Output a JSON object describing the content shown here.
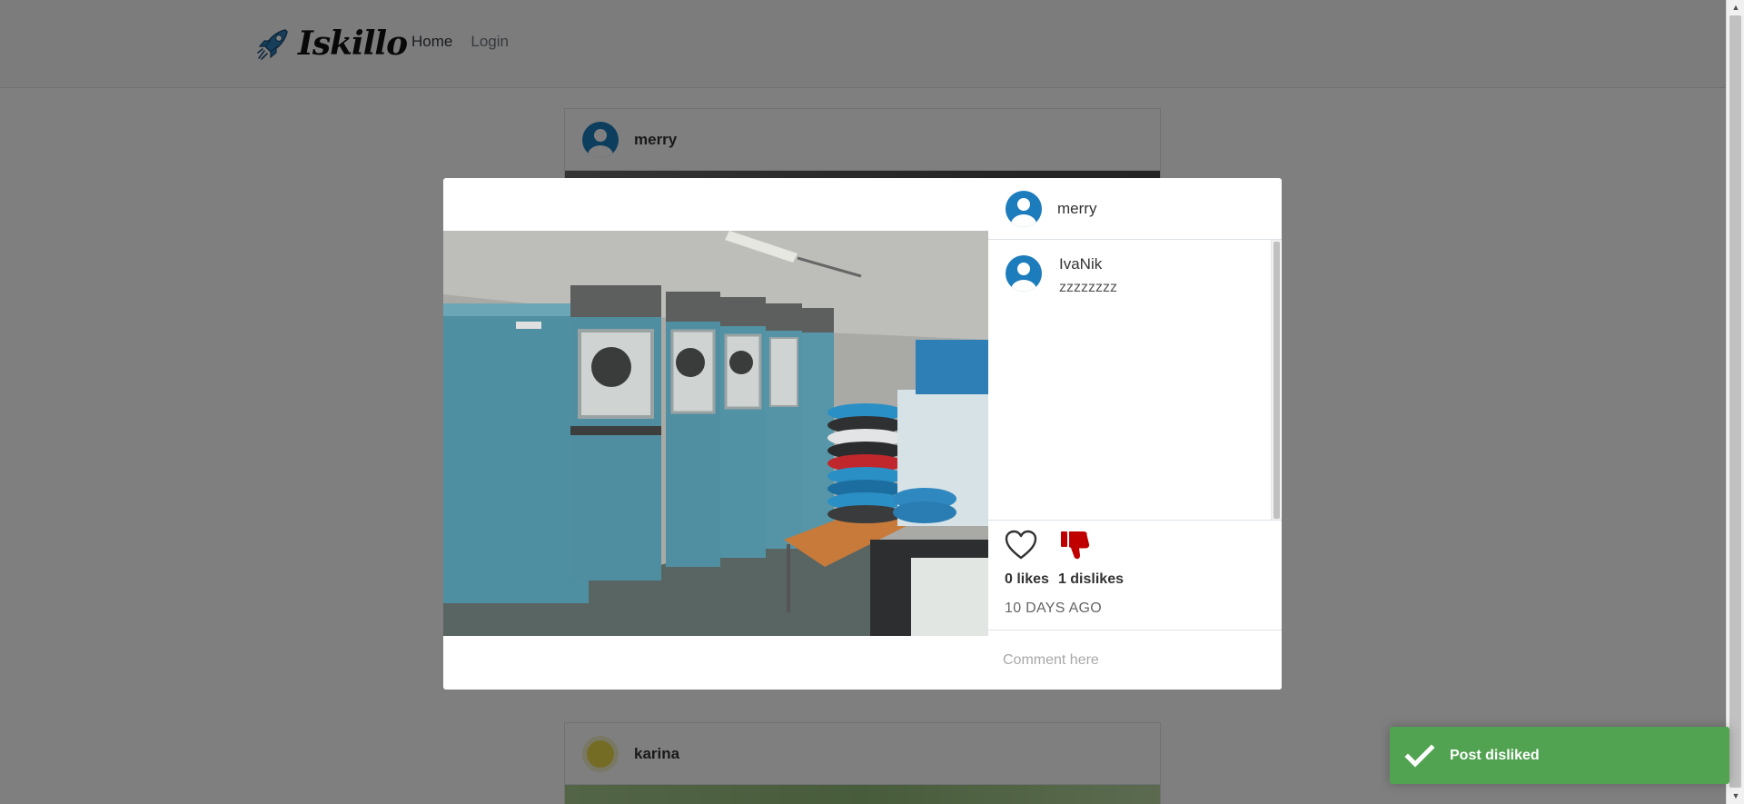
{
  "navbar": {
    "brand": "Iskillo",
    "links": [
      {
        "label": "Home",
        "active": true
      },
      {
        "label": "Login",
        "active": false
      }
    ]
  },
  "feed": {
    "posts": [
      {
        "username": "merry"
      },
      {
        "username": "karina"
      }
    ]
  },
  "modal": {
    "author": "merry",
    "comments": [
      {
        "user": "IvaNik",
        "text": "zzzzzzzz"
      }
    ],
    "likes_label": "0 likes",
    "dislikes_label": "1 dislikes",
    "liked": false,
    "disliked": true,
    "timestamp": "10 DAYS AGO",
    "comment_placeholder": "Comment here"
  },
  "toast": {
    "message": "Post disliked",
    "color": "#51a351"
  },
  "colors": {
    "avatar_blue": "#1c7cbc",
    "dislike_red": "#c00000"
  }
}
